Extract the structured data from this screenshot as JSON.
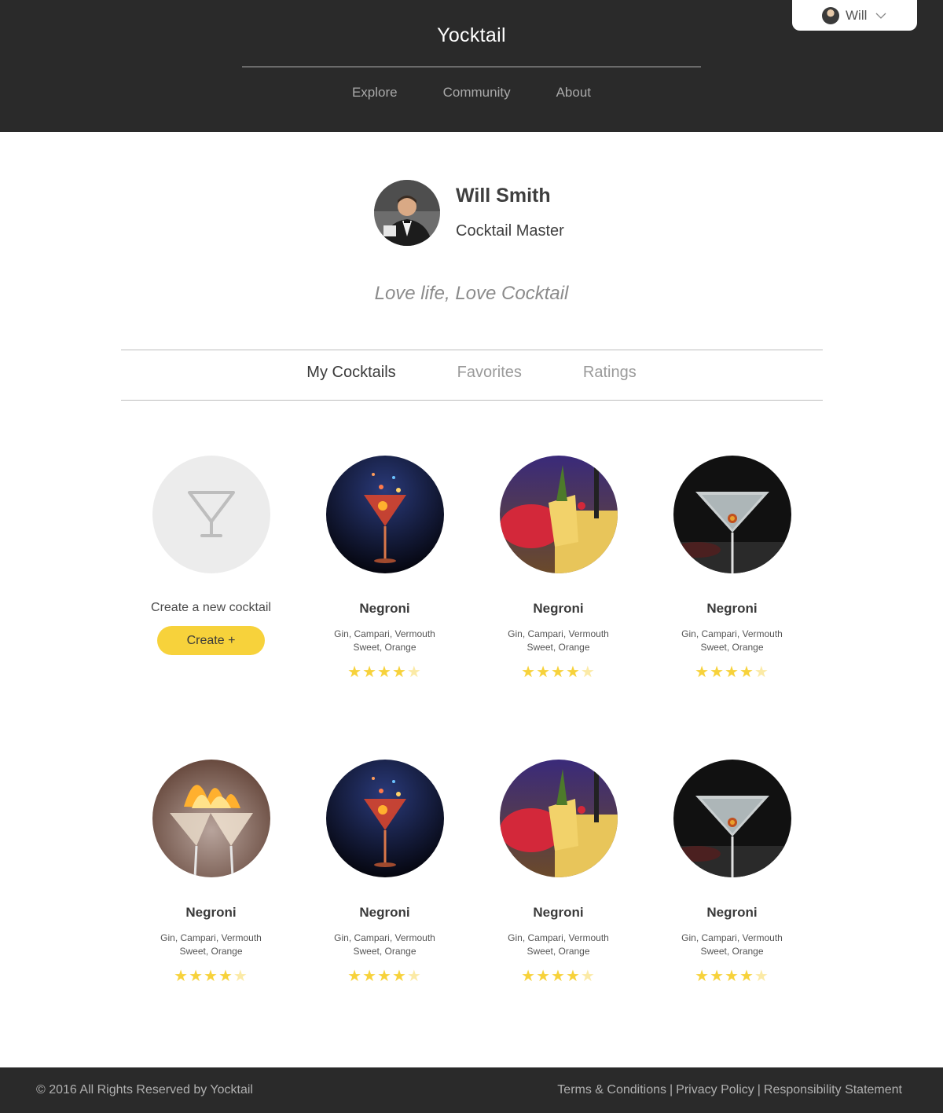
{
  "header": {
    "brand": "Yocktail",
    "nav": [
      "Explore",
      "Community",
      "About"
    ],
    "user": {
      "name": "Will"
    }
  },
  "profile": {
    "name": "Will Smith",
    "role": "Cocktail Master",
    "motto": "Love life, Love Cocktail"
  },
  "tabs": [
    "My Cocktails",
    "Favorites",
    "Ratings"
  ],
  "active_tab": "My Cocktails",
  "create": {
    "label": "Create a new cocktail",
    "button": "Create  +"
  },
  "cocktails": [
    {
      "name": "Negroni",
      "ingredients_1": "Gin, Campari, Vermouth",
      "ingredients_2": "Sweet, Orange",
      "rating": 4,
      "image": "splash-martini"
    },
    {
      "name": "Negroni",
      "ingredients_1": "Gin, Campari, Vermouth",
      "ingredients_2": "Sweet, Orange",
      "rating": 4,
      "image": "tropical-pineapple"
    },
    {
      "name": "Negroni",
      "ingredients_1": "Gin, Campari, Vermouth",
      "ingredients_2": "Sweet, Orange",
      "rating": 4,
      "image": "olive-martini"
    },
    {
      "name": "Negroni",
      "ingredients_1": "Gin, Campari, Vermouth",
      "ingredients_2": "Sweet, Orange",
      "rating": 4,
      "image": "flaming-glasses"
    },
    {
      "name": "Negroni",
      "ingredients_1": "Gin, Campari, Vermouth",
      "ingredients_2": "Sweet, Orange",
      "rating": 4,
      "image": "splash-martini"
    },
    {
      "name": "Negroni",
      "ingredients_1": "Gin, Campari, Vermouth",
      "ingredients_2": "Sweet, Orange",
      "rating": 4,
      "image": "tropical-pineapple"
    },
    {
      "name": "Negroni",
      "ingredients_1": "Gin, Campari, Vermouth",
      "ingredients_2": "Sweet, Orange",
      "rating": 4,
      "image": "olive-martini"
    }
  ],
  "rating_max": 5,
  "footer": {
    "copyright": "© 2016 All Rights Reserved by Yocktail",
    "links": [
      "Terms & Conditions",
      "Privacy Policy",
      "Responsibility Statement"
    ]
  },
  "colors": {
    "dark": "#2a2a2a",
    "accent": "#f7d23b"
  }
}
